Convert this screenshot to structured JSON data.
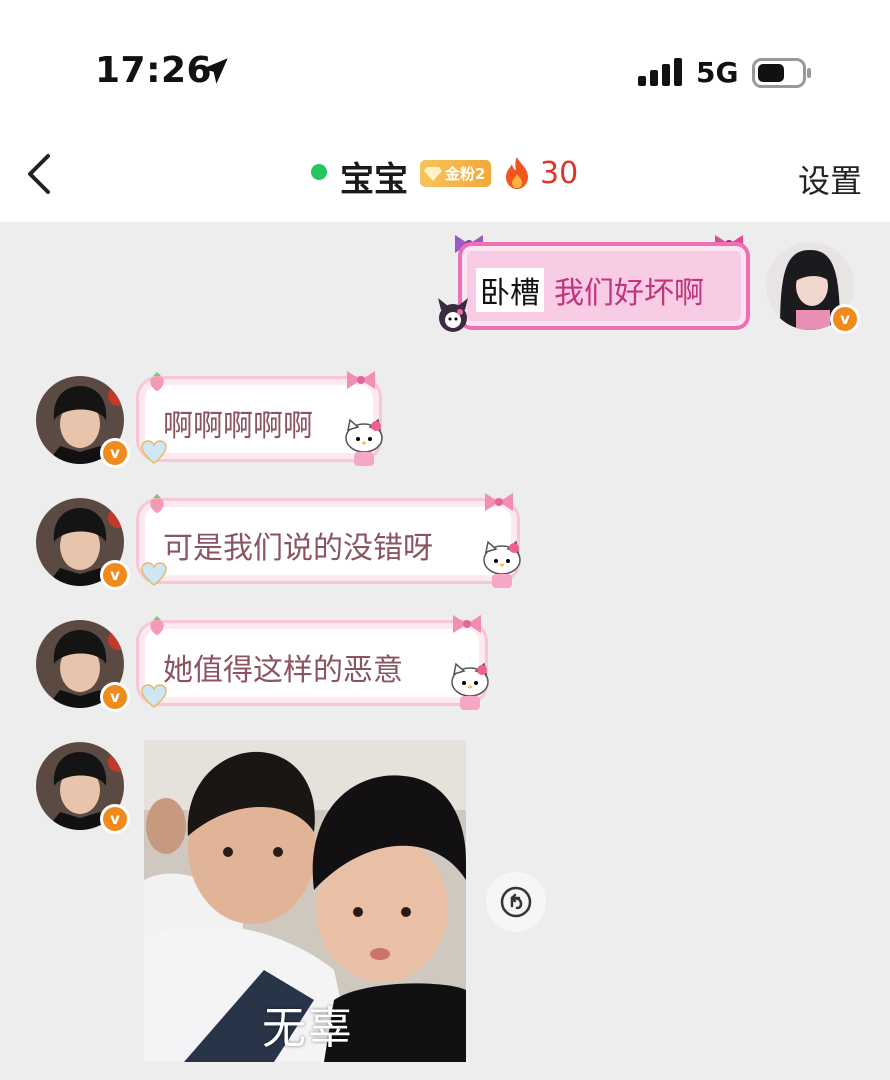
{
  "status_bar": {
    "time": "17:26",
    "network": "5G"
  },
  "header": {
    "chat_name": "宝宝",
    "fan_badge": "金粉2",
    "streak": "30",
    "settings_label": "设置"
  },
  "messages": {
    "outgoing": {
      "highlight": "卧槽",
      "text": "我们好坏啊"
    },
    "incoming": [
      {
        "text": "啊啊啊啊啊"
      },
      {
        "text": "可是我们说的没错呀"
      },
      {
        "text": "她值得这样的恶意"
      }
    ],
    "image_caption": "无辜"
  },
  "colors": {
    "accent_orange": "#f08a1c",
    "online_green": "#22c55e",
    "streak_red": "#e0342b",
    "bubble_pink": "#ef6fb4"
  }
}
